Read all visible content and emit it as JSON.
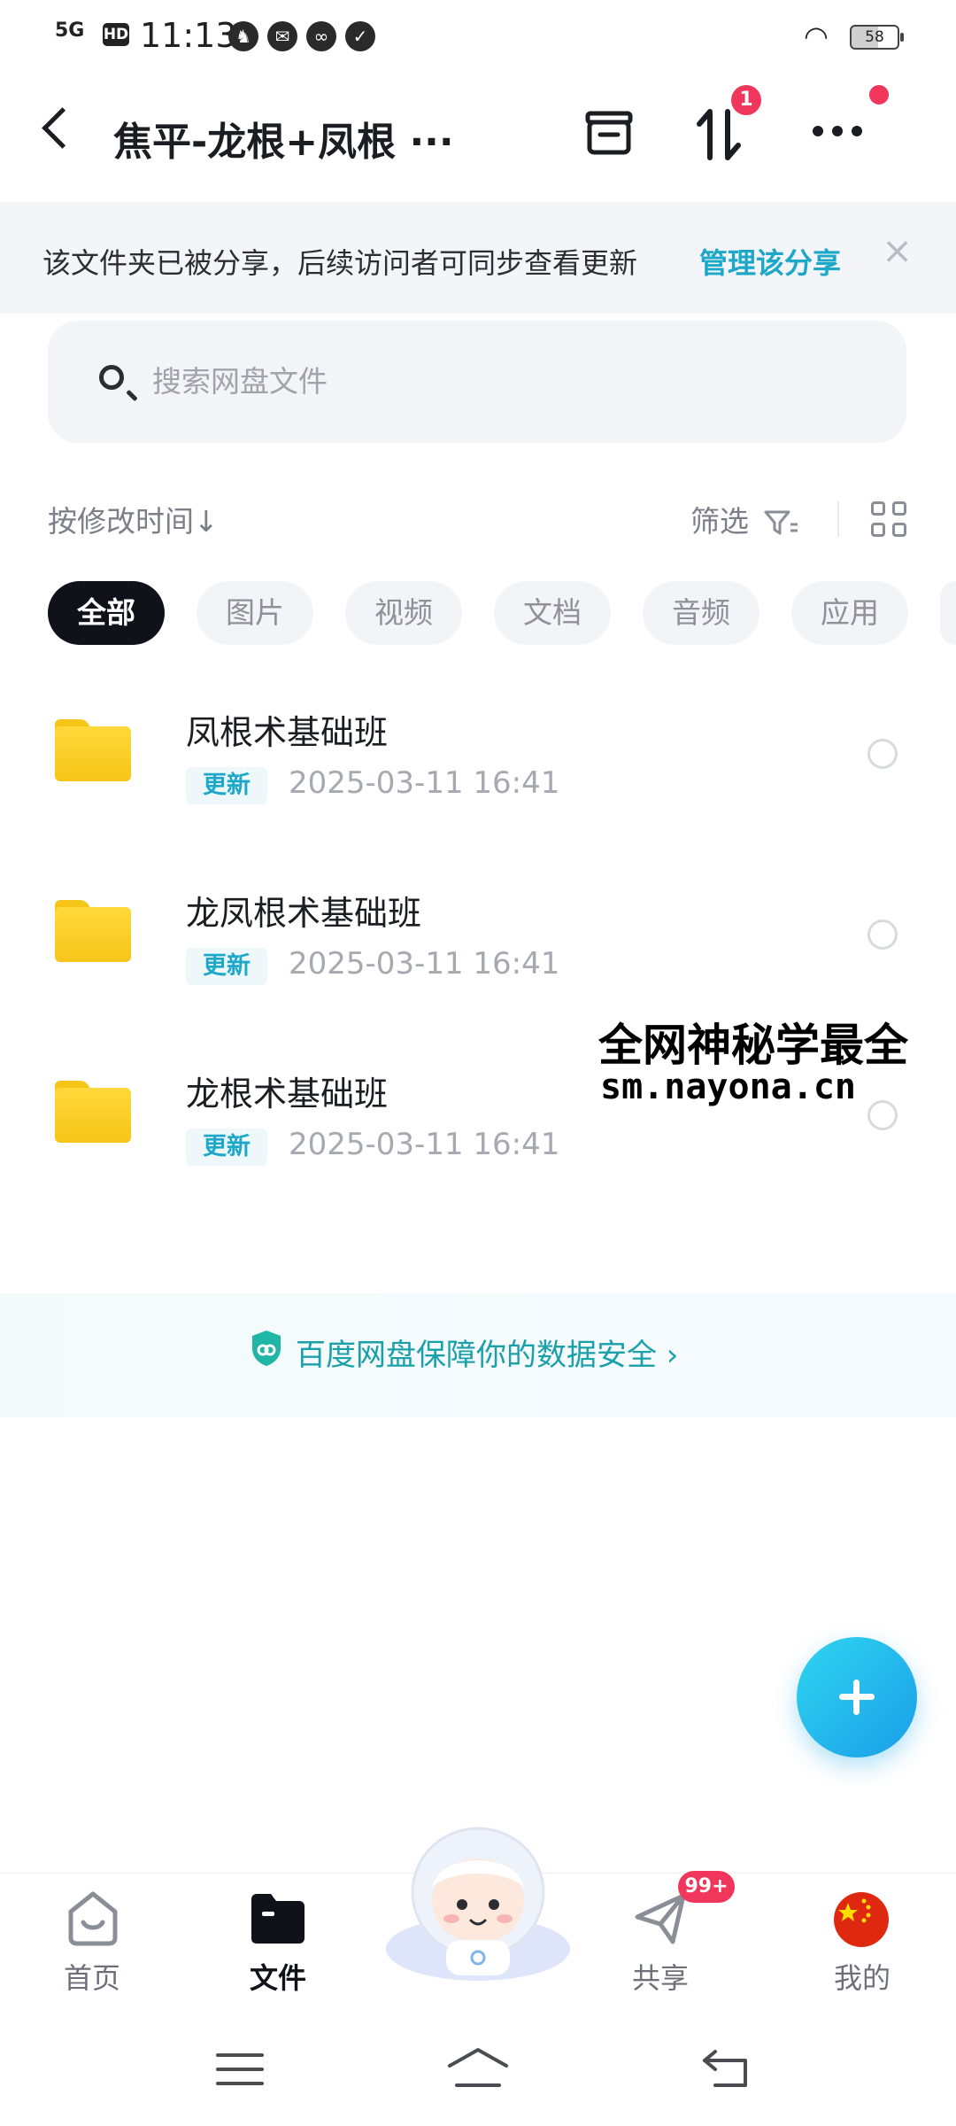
{
  "status_bar": {
    "network": "5G",
    "hd": "HD",
    "time": "11:13",
    "battery": "58"
  },
  "header": {
    "title": "焦平-龙根+凤根 ···",
    "transfer_badge": "1"
  },
  "share_banner": {
    "text": "该文件夹已被分享，后续访问者可同步查看更新",
    "link": "管理该分享",
    "close": "×"
  },
  "search": {
    "placeholder": "搜索网盘文件"
  },
  "toolbar": {
    "sort_label": "按修改时间↓",
    "filter_label": "筛选"
  },
  "tabs": [
    {
      "label": "全部"
    },
    {
      "label": "图片"
    },
    {
      "label": "视频"
    },
    {
      "label": "文档"
    },
    {
      "label": "音频"
    },
    {
      "label": "应用"
    }
  ],
  "files": [
    {
      "name": "凤根术基础班",
      "tag": "更新",
      "date": "2025-03-11  16:41"
    },
    {
      "name": "龙凤根术基础班",
      "tag": "更新",
      "date": "2025-03-11  16:41"
    },
    {
      "name": "龙根术基础班",
      "tag": "更新",
      "date": "2025-03-11  16:41"
    }
  ],
  "watermark": {
    "line1": "全网神秘学最全",
    "line2": "sm.nayona.cn"
  },
  "security": {
    "text": "百度网盘保障你的数据安全 ›"
  },
  "bottom_nav": [
    {
      "label": "首页"
    },
    {
      "label": "文件"
    },
    {
      "label": "共享"
    },
    {
      "label": "我的"
    }
  ],
  "share_badge": "99+",
  "colors": {
    "accent": "#1da8c9",
    "fab": "#1a9ee8",
    "badge": "#f0365a",
    "folder": "#f5c518"
  }
}
